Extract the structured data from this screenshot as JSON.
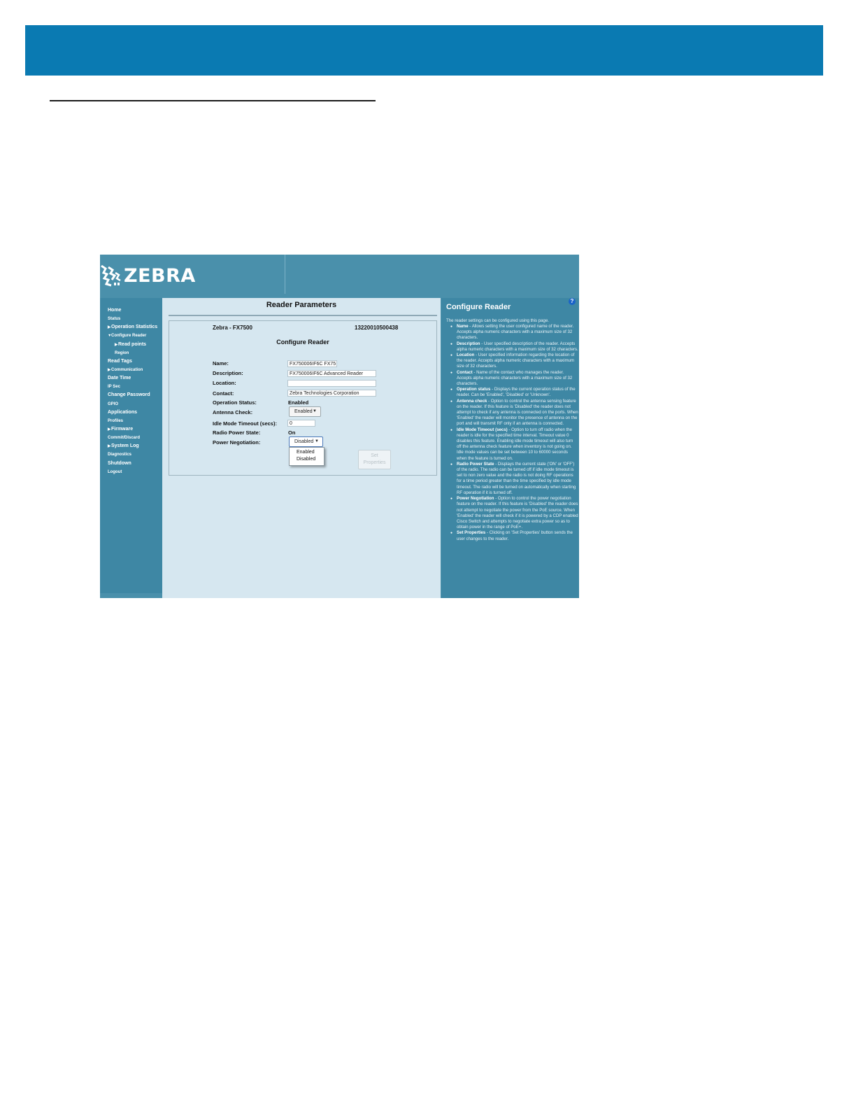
{
  "app": {
    "brand": "ZEBRA"
  },
  "nav": {
    "items": [
      {
        "label": "Home",
        "arrow": "",
        "sub": false,
        "small": false
      },
      {
        "label": "Status",
        "arrow": "",
        "sub": false,
        "small": true
      },
      {
        "label": "Operation Statistics",
        "arrow": "▶",
        "sub": false,
        "small": false
      },
      {
        "label": "Configure Reader",
        "arrow": "▼",
        "sub": false,
        "small": true
      },
      {
        "label": "Read points",
        "arrow": "▶",
        "sub": true,
        "small": false
      },
      {
        "label": "Region",
        "arrow": "",
        "sub": true,
        "small": true
      },
      {
        "label": "Read Tags",
        "arrow": "",
        "sub": false,
        "small": false
      },
      {
        "label": "Communication",
        "arrow": "▶",
        "sub": false,
        "small": true
      },
      {
        "label": "Date Time",
        "arrow": "",
        "sub": false,
        "small": false
      },
      {
        "label": "IP Sec",
        "arrow": "",
        "sub": false,
        "small": true
      },
      {
        "label": "Change Password",
        "arrow": "",
        "sub": false,
        "small": false
      },
      {
        "label": "GPIO",
        "arrow": "",
        "sub": false,
        "small": true
      },
      {
        "label": "Applications",
        "arrow": "",
        "sub": false,
        "small": false
      },
      {
        "label": "Profiles",
        "arrow": "",
        "sub": false,
        "small": true
      },
      {
        "label": "Firmware",
        "arrow": "▶",
        "sub": false,
        "small": false
      },
      {
        "label": "Commit/Discard",
        "arrow": "",
        "sub": false,
        "small": true
      },
      {
        "label": "System Log",
        "arrow": "▶",
        "sub": false,
        "small": false
      },
      {
        "label": "Diagnostics",
        "arrow": "",
        "sub": false,
        "small": true
      },
      {
        "label": "Shutdown",
        "arrow": "",
        "sub": false,
        "small": false
      },
      {
        "label": "Logout",
        "arrow": "",
        "sub": false,
        "small": true
      }
    ]
  },
  "main": {
    "title": "Reader Parameters",
    "model": "Zebra - FX7500",
    "serial": "13220010500438",
    "subtitle": "Configure Reader",
    "labels": {
      "name": "Name:",
      "description": "Description:",
      "location": "Location:",
      "contact": "Contact:",
      "operation_status": "Operation Status:",
      "antenna_check": "Antenna Check:",
      "idle_mode": "Idle Mode Timeout (secs):",
      "radio_power": "Radio Power State:",
      "power_negotiation": "Power Negotiation:"
    },
    "values": {
      "name": "FX750006IF6C FX75",
      "description": "FX750006IF6C Advanced Reader",
      "location": "",
      "contact": "Zebra Technologies Corporation",
      "operation_status": "Enabled",
      "antenna_check": "Enabled",
      "idle_mode": "0",
      "radio_power": "On",
      "power_negotiation": "Disabled"
    },
    "dropdown_options": [
      "Enabled",
      "Disabled"
    ],
    "set_button_line1": "Set",
    "set_button_line2": "Properties"
  },
  "help": {
    "title": "Configure Reader",
    "icon": "?",
    "intro": "The reader settings can be configured using this page.",
    "items": [
      {
        "term": "Name",
        "text": " - Allows setting the user configured name of the reader. Accepts alpha numeric characters with a maximum size of 32 characters."
      },
      {
        "term": "Description",
        "text": " - User specified description of the reader. Accepts alpha numeric characters with a maximum size of 32 characters."
      },
      {
        "term": "Location",
        "text": " - User specified information regarding the location of the reader. Accepts alpha numeric characters with a maximum size of 32 characters."
      },
      {
        "term": "Contact",
        "text": " - Name of the contact who manages the reader. Accepts alpha numeric characters with a maximum size of 32 characters."
      },
      {
        "term": "Operation status",
        "text": " - Displays the current operation status of the reader. Can be 'Enabled', 'Disabled' or 'Unknown'."
      },
      {
        "term": "Antenna check",
        "text": " - Option to control the antenna sensing feature on the reader. If this feature is 'Disabled' the reader does not attempt to check if any antenna is connected on the ports. When 'Enabled' the reader will monitor the presence of antenna on the port and will transmit RF only if an antenna is connected."
      },
      {
        "term": "Idle Mode Timeout (secs)",
        "text": " - Option to turn off radio when the reader is idle for the specified time interval. Timeout value 0 disables this feature. Enabling idle mode timeout will also turn off the antenna check feature when inventory is not going on. Idle mode values can be set between 10 to 60000 seconds when the feature is turned on."
      },
      {
        "term": "Radio Power State",
        "text": " - Displays the current state ('ON' or 'OFF') of the radio. The radio can be turned off if idle mode timeout is set to non zero value and the radio is not doing RF operations for a time period greater than the time specified by idle mode timeout. The radio will be turned on automatically when starting RF operation if it is turned off."
      },
      {
        "term": "Power Negotiation",
        "text": " - Option to control the power negotiation feature on the reader. If this feature is 'Disabled' the reader does not attempt to negotiate the power from the PoE source. When 'Enabled' the reader will check if it is powered by a CDP enabled Cisco Switch and attempts to negotiate extra power so as to obtain power in the range of PoE+."
      },
      {
        "term": "Set Properties",
        "text": " - Clicking on 'Set Properties' button sends the user changes to the reader."
      }
    ]
  },
  "colors": {
    "doc_banner": "#0a7ab2",
    "app_header": "#4a90ab",
    "sidebar": "#3e87a4",
    "content_bg": "#d6e7f0",
    "help_icon": "#1a64c8"
  }
}
